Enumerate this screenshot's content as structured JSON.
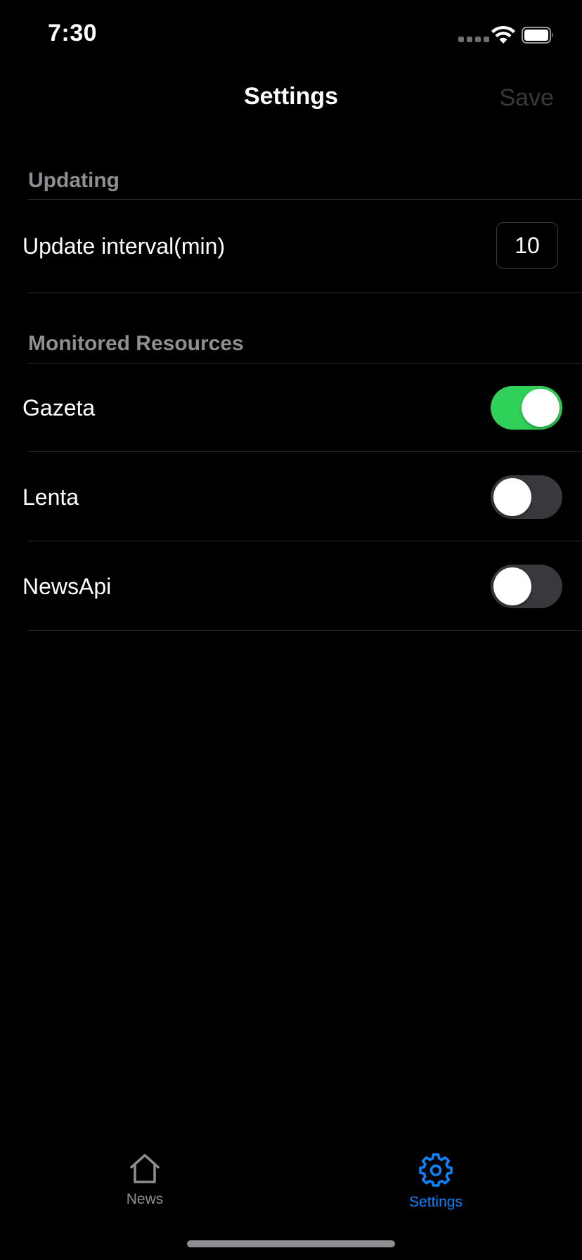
{
  "status_bar": {
    "time": "7:30"
  },
  "nav": {
    "title": "Settings",
    "save_label": "Save"
  },
  "sections": {
    "updating": {
      "header": "Updating",
      "interval_label": "Update interval(min)",
      "interval_value": "10"
    },
    "resources": {
      "header": "Monitored Resources",
      "items": [
        {
          "label": "Gazeta",
          "enabled": true
        },
        {
          "label": "Lenta",
          "enabled": false
        },
        {
          "label": "NewsApi",
          "enabled": false
        }
      ]
    }
  },
  "tab_bar": {
    "tabs": [
      {
        "label": "News",
        "icon": "house-icon",
        "selected": false
      },
      {
        "label": "Settings",
        "icon": "gear-icon",
        "selected": true
      }
    ]
  },
  "colors": {
    "accent": "#0a84ff",
    "toggle_on": "#30d158",
    "toggle_off": "#39393d",
    "secondary_text": "#8e8e93"
  }
}
